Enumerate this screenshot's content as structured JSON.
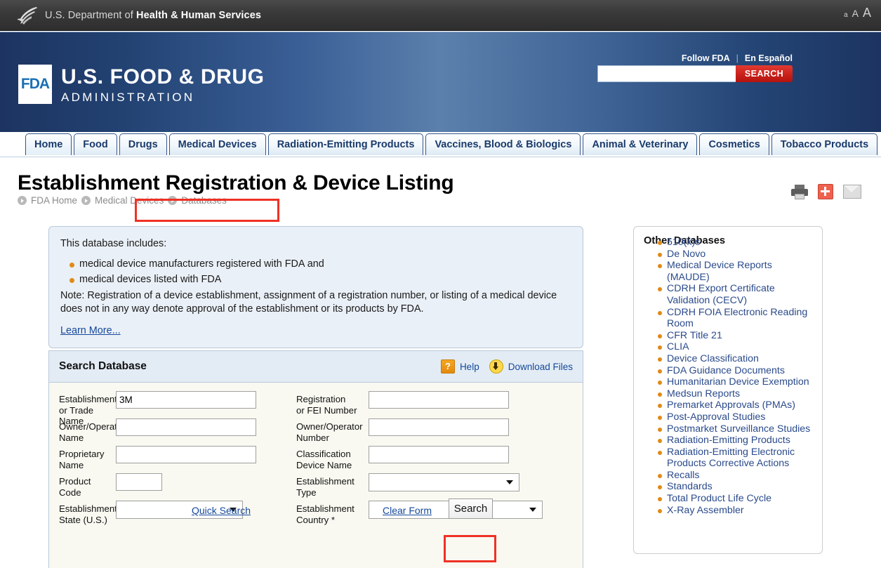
{
  "hhs_bar": {
    "logo_name": "hhs-eagle-logo",
    "text_prefix": "U.S. Department of ",
    "text_bold": "Health & Human Services",
    "font_sizes": [
      "a",
      "A",
      "A"
    ]
  },
  "fda_banner": {
    "mark": "FDA",
    "line1": "U.S. FOOD & DRUG",
    "line2": "ADMINISTRATION",
    "follow_link": "Follow FDA",
    "separator": "|",
    "espanol_link": "En Español",
    "search_value": "",
    "search_placeholder": "",
    "search_button": "SEARCH"
  },
  "nav": {
    "tabs": [
      {
        "label": "Home",
        "active": true
      },
      {
        "label": "Food",
        "active": false
      },
      {
        "label": "Drugs",
        "active": false
      },
      {
        "label": "Medical Devices",
        "active": false
      },
      {
        "label": "Radiation-Emitting Products",
        "active": false
      },
      {
        "label": "Vaccines, Blood & Biologics",
        "active": false
      },
      {
        "label": "Animal & Veterinary",
        "active": false
      },
      {
        "label": "Cosmetics",
        "active": false
      },
      {
        "label": "Tobacco Products",
        "active": false
      }
    ]
  },
  "page": {
    "title": "Establishment Registration & Device Listing",
    "breadcrumb": [
      "FDA Home",
      "Medical Devices",
      "Databases"
    ],
    "icons": [
      "print-icon",
      "pdf-icon",
      "email-icon"
    ]
  },
  "info_box": {
    "intro": "This database includes:",
    "bullets": [
      "medical device manufacturers registered with FDA and",
      "medical devices listed with FDA"
    ],
    "note": "Note: Registration of a device establishment, assignment of a registration number, or listing of a medical device does not in any way denote approval of the establishment or its products by FDA.",
    "learn_more": "Learn More..."
  },
  "search_panel": {
    "title": "Search Database",
    "help_label": "Help",
    "help_icon": "question-mark-icon",
    "download_label": "Download Files",
    "download_icon": "download-arrow-icon",
    "fields_left": [
      {
        "label": "Establishment\nor Trade Name",
        "label_l1": "Establishment",
        "label_l2": "or Trade Name",
        "type": "text",
        "value": "3M",
        "width": "w200",
        "highlighted": true
      },
      {
        "label_l1": "Owner/Operator",
        "label_l2": "Name",
        "type": "text",
        "value": "",
        "width": "w200",
        "highlighted": false
      },
      {
        "label_l1": "Proprietary",
        "label_l2": "Name",
        "type": "text",
        "value": "",
        "width": "w200",
        "highlighted": false
      },
      {
        "label_l1": "Product",
        "label_l2": "Code",
        "type": "text",
        "value": "",
        "width": "w66",
        "highlighted": false
      },
      {
        "label_l1": "Establishment",
        "label_l2": "State (U.S.)",
        "type": "select",
        "value": "",
        "width": "w181",
        "highlighted": false
      }
    ],
    "fields_right": [
      {
        "label_l1": "Registration",
        "label_l2": "or FEI Number",
        "type": "text",
        "value": "",
        "width": "w200",
        "highlighted": false
      },
      {
        "label_l1": "Owner/Operator",
        "label_l2": "Number",
        "type": "text",
        "value": "",
        "width": "w200",
        "highlighted": false
      },
      {
        "label_l1": "Classification",
        "label_l2": "Device Name",
        "type": "text",
        "value": "",
        "width": "w200",
        "highlighted": false
      },
      {
        "label_l1": "Establishment",
        "label_l2": "Type",
        "type": "select",
        "value": "",
        "width": "w215",
        "highlighted": false
      },
      {
        "label_l1": "Establishment",
        "label_l2": "Country *",
        "type": "select",
        "value": "",
        "width": "w248",
        "highlighted": false
      }
    ],
    "quick_search": "Quick Search",
    "clear_form": "Clear Form",
    "search_button": "Search",
    "highlight_color": "#ef3124"
  },
  "other_databases": {
    "title": "Other Databases",
    "items": [
      "510(k)s",
      "De Novo",
      "Medical Device Reports (MAUDE)",
      "CDRH Export Certificate Validation (CECV)",
      "CDRH FOIA Electronic Reading Room",
      "CFR Title 21",
      "CLIA",
      "Device Classification",
      "FDA Guidance Documents",
      "Humanitarian Device Exemption",
      "Medsun Reports",
      "Premarket Approvals (PMAs)",
      "Post-Approval Studies",
      "Postmarket Surveillance Studies",
      "Radiation-Emitting Products",
      "Radiation-Emitting Electronic Products Corrective Actions",
      "Recalls",
      "Standards",
      "Total Product Life Cycle",
      "X-Ray Assembler"
    ]
  },
  "colors": {
    "hhs_bar": "#3a3a3a",
    "fda_blue_dark": "#1d3461",
    "fda_blue_light": "#5b80ac",
    "search_red": "#c9201a",
    "link_blue": "#15489a",
    "bullet_orange": "#e08a16",
    "highlight_red": "#ef3124"
  }
}
